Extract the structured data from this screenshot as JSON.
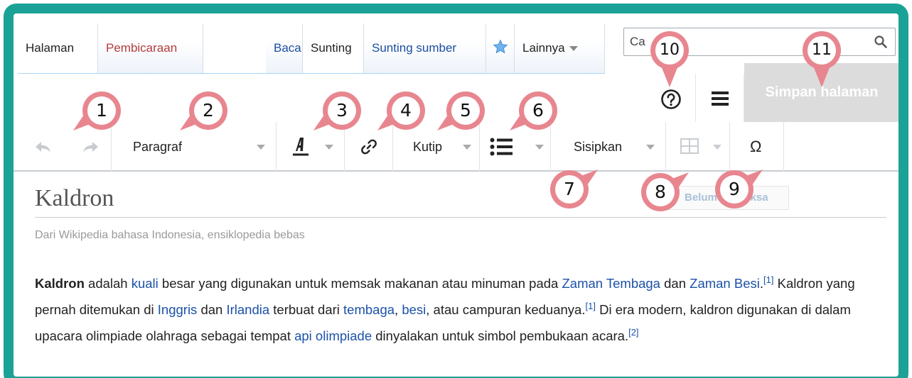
{
  "tabs": {
    "halaman": "Halaman",
    "pembicaraan": "Pembicaraan",
    "baca": "Baca",
    "sunting": "Sunting",
    "sunting_sumber": "Sunting sumber",
    "watch_icon": "star-icon",
    "lainnya": "Lainnya"
  },
  "search": {
    "value": "Ca",
    "icon": "search-icon"
  },
  "actions": {
    "help_icon": "help-icon",
    "menu_icon": "hamburger-menu-icon",
    "save_label": "Simpan halaman"
  },
  "toolbar": {
    "undo_icon": "undo-icon",
    "redo_icon": "redo-icon",
    "paragraph_label": "Paragraf",
    "text_style_icon": "text-style-icon",
    "link_icon": "link-icon",
    "cite_label": "Kutip",
    "list_icon": "list-icon",
    "insert_label": "Sisipkan",
    "table_icon": "table-icon",
    "special_char": "Ω"
  },
  "article": {
    "title": "Kaldron",
    "review_badge": "Belum Diperiksa",
    "tagline": "Dari Wikipedia bahasa Indonesia, ensiklopedia bebas",
    "p_bold": "Kaldron",
    "t1": " adalah ",
    "l_kuali": "kuali",
    "t2": " besar yang digunakan untuk memsak makanan atau minuman pada ",
    "l_zaman_tembaga": "Zaman Tembaga",
    "t3": " dan ",
    "l_zaman_besi": "Zaman Besi",
    "t4": ".",
    "ref1a": "[1]",
    "t5": " Kaldron yang pernah ditemukan di ",
    "l_inggris": "Inggris",
    "t6": " dan ",
    "l_irlandia": "Irlandia",
    "t7": " terbuat dari ",
    "l_tembaga": "tembaga",
    "t8": ", ",
    "l_besi": "besi",
    "t9": ", atau campuran keduanya.",
    "ref1b": "[1]",
    "t10": " Di era modern, kaldron digunakan di dalam upacara olimpiade olahraga sebagai tempat ",
    "l_api": "api olimpiade",
    "t11": " dinyalakan untuk simbol pembukaan acara.",
    "ref2": "[2]"
  },
  "callouts": [
    "1",
    "2",
    "3",
    "4",
    "5",
    "6",
    "7",
    "8",
    "9",
    "10",
    "11"
  ],
  "colors": {
    "frame": "#1ba297",
    "callout": "#e8868f",
    "link": "#1b52a8"
  }
}
